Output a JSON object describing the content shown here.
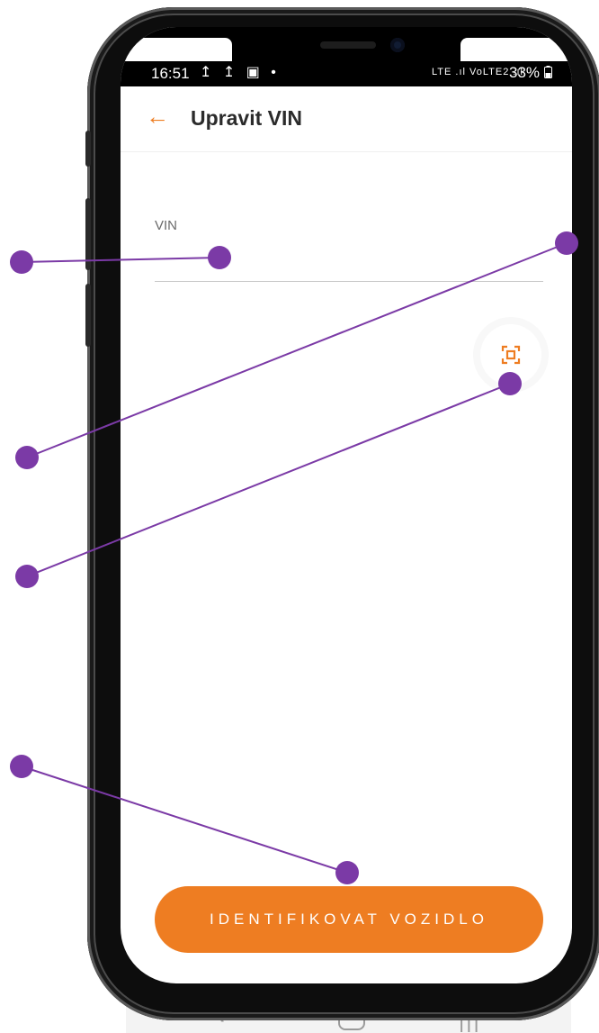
{
  "status_bar": {
    "time": "16:51",
    "left_icons": "↥ ↥ ▣ •",
    "right_icons": "LTE .ıl VoLTE2 .ıl",
    "battery": "33%"
  },
  "app_bar": {
    "title": "Upravit VIN",
    "back_icon": "arrow-left-icon"
  },
  "form": {
    "vin_label": "VIN",
    "vin_value": "",
    "scan_icon": "scan-frame-icon"
  },
  "actions": {
    "primary_label": "IDENTIFIKOVAT VOZIDLO"
  },
  "colors": {
    "accent": "#ee7d22",
    "annotation": "#7b3aa6"
  }
}
